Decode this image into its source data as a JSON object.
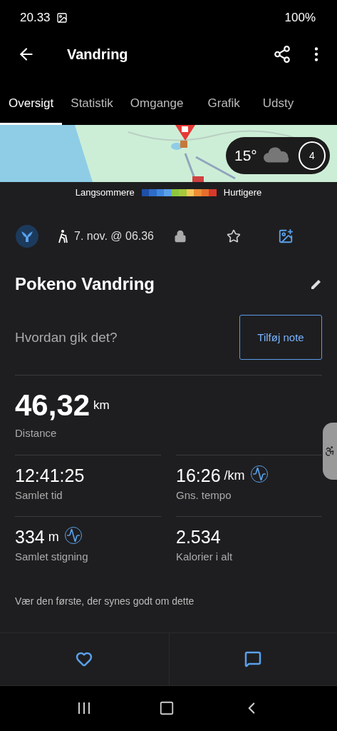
{
  "status_bar": {
    "time": "20.33",
    "battery": "100%"
  },
  "app_bar": {
    "title": "Vandring"
  },
  "tabs": [
    {
      "label": "Oversigt",
      "selected": true
    },
    {
      "label": "Statistik",
      "selected": false
    },
    {
      "label": "Omgange",
      "selected": false
    },
    {
      "label": "Grafik",
      "selected": false
    },
    {
      "label": "Udsty",
      "selected": false
    }
  ],
  "map": {
    "kind": "picture",
    "weather": {
      "temperature": "15°",
      "wind": "4"
    }
  },
  "legend": {
    "slow_label": "Langsommere",
    "fast_label": "Hurtigere"
  },
  "meta": {
    "date": "7. nov. @ 06.36"
  },
  "activity": {
    "title": "Pokeno Vandring",
    "note_prompt": "Hvordan gik det?",
    "note_button": "Tilføj note"
  },
  "distance": {
    "value": "46,32",
    "unit": "km",
    "label": "Distance"
  },
  "stats": [
    {
      "value": "12:41:25",
      "label": "Samlet tid",
      "chart": false
    },
    {
      "value": "16:26",
      "unit": "/km",
      "label": "Gns. tempo",
      "chart": true
    },
    {
      "value": "334",
      "unit": "m",
      "label": "Samlet stigning",
      "chart": true
    },
    {
      "value": "2.534",
      "label": "Kalorier i alt",
      "chart": false
    }
  ],
  "likes_text": "Vær den første, der synes godt om dette"
}
